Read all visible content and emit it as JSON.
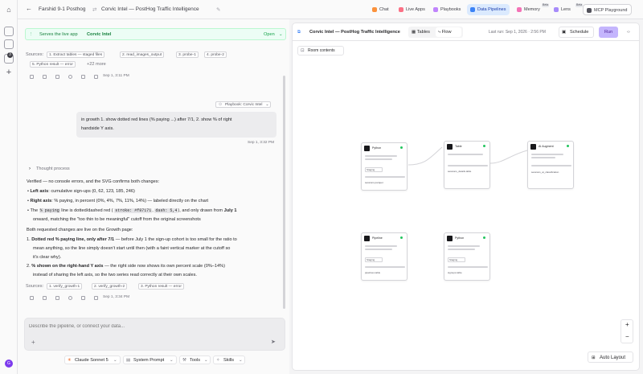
{
  "rail": {
    "badge": "3"
  },
  "topbar": {
    "workspace": "Farshid 9-1 Posthog",
    "project": "Corvic Intel — PostHog Traffic Intelligence",
    "tabs": [
      {
        "label": "Chat",
        "beta": ""
      },
      {
        "label": "Live Apps",
        "beta": ""
      },
      {
        "label": "Playbooks",
        "beta": ""
      },
      {
        "label": "Data Pipelines",
        "beta": ""
      },
      {
        "label": "Memory",
        "beta": "Beta"
      },
      {
        "label": "Lens",
        "beta": "Beta"
      }
    ],
    "mcp": "MCP Playground"
  },
  "banner": {
    "text": "Serves the live app",
    "app": "Corvic Intel",
    "open": "Open"
  },
  "sources1": {
    "label": "Sources:",
    "chips": [
      "1. Extract tables — staged files",
      "2. read_images_output",
      "3. probe-1",
      "4. probe-2",
      "5. Python result — error"
    ],
    "more": "+22 more",
    "time": "Sep 1, 3:11 PM"
  },
  "playbook_tag": "Playbook: Corvic Intel",
  "user_msg": {
    "line1": "in growth 1. show dotted red lines (% paying ...) after 7/1, 2. show % of right",
    "line2": "handside Y axis.",
    "time": "Sep 1, 3:32 PM"
  },
  "thought": "Thought process",
  "reply": {
    "intro": "Verified — no console errors, and the SVG confirms both changes:",
    "b1_bold": "Left axis",
    "b1": ": cumulative sign-ups (0, 62, 123, 185, 246)",
    "b2_bold": "Right axis",
    "b2": ": % paying, in percent (0%, 4%, 7%, 11%, 14%) — labeled directly on the chart",
    "b3_pre": "The",
    "b3_code1": "% paying",
    "b3_mid": "line is dotted/dashed red (",
    "b3_code2": "stroke: #f87171",
    "b3_comma": ",",
    "b3_code3": "dash: 5,4",
    "b3_post": "), and only drawn from",
    "b3_bold": "July 1",
    "b3_l2": "onward, matching the \"too thin to be meaningful\" cutoff from the original screenshots",
    "live": "Both requested changes are live on the Growth page:",
    "n1_bold": "Dotted red % paying line, only after 7/1",
    "n1": "— before July 1 the sign-up cohort is too small for the ratio to",
    "n1_l2": "mean anything, so the line simply doesn't start until then (with a faint vertical marker at the cutoff so",
    "n1_l3": "it's clear why).",
    "n2_bold": "% shown on the right-hand Y axis",
    "n2": "— the right side now shows its own percent scale (0%–14%)",
    "n2_l2": "instead of sharing the left axis, so the two series read correctly at their own scales."
  },
  "sources2": {
    "label": "Sources:",
    "chips": [
      "1. verify_growth-1",
      "2. verify_growth-2",
      "3. Python result — error"
    ],
    "time": "Sep 1, 3:34 PM"
  },
  "composer": {
    "placeholder": "Describe the pipeline, or connect your data..."
  },
  "bottom": {
    "model": "Claude Sonnet 5",
    "system": "System Prompt",
    "tools": "Tools",
    "skills": "Skills"
  },
  "pipeline": {
    "title": "Corvic Intel — PostHog Traffic Intelligence",
    "tables": "Tables",
    "flow": "Flow",
    "last_run": "Last run: Sep 1, 2026 · 2:56 PM",
    "schedule": "Schedule",
    "run": "Run",
    "room": "Room contents",
    "auto": "Auto Layout",
    "zoom_in": "+",
    "zoom_out": "−"
  },
  "nodes": [
    {
      "title": "Python",
      "tag": "Staging",
      "out": "sessions.parquet"
    },
    {
      "title": "Table",
      "tag": "",
      "out": "sessions_details.table"
    },
    {
      "title": "AI Augment",
      "tag": "",
      "out": "sessions_ai_classification"
    },
    {
      "title": "Pipeline",
      "tag": "Staging",
      "out": "pipelines.table"
    },
    {
      "title": "Python",
      "tag": "Staging",
      "out": "signups.table"
    }
  ]
}
